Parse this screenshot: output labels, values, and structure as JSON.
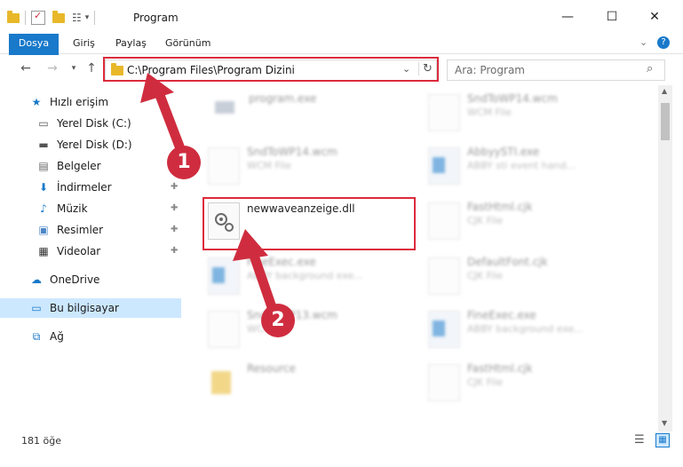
{
  "window": {
    "title": "Program"
  },
  "ribbon": {
    "tabs": [
      "Dosya",
      "Giriş",
      "Paylaş",
      "Görünüm"
    ]
  },
  "address": {
    "path": "C:\\Program Files\\Program Dizini"
  },
  "search": {
    "placeholder": "Ara: Program"
  },
  "sidebar": {
    "items": [
      {
        "label": "Hızlı erişim"
      },
      {
        "label": "Yerel Disk (C:)"
      },
      {
        "label": "Yerel Disk (D:)"
      },
      {
        "label": "Belgeler"
      },
      {
        "label": "İndirmeler"
      },
      {
        "label": "Müzik"
      },
      {
        "label": "Resimler"
      },
      {
        "label": "Videolar"
      },
      {
        "label": "OneDrive"
      },
      {
        "label": "Bu bilgisayar"
      },
      {
        "label": "Ağ"
      }
    ]
  },
  "files": [
    {
      "name": "program.exe",
      "type": ""
    },
    {
      "name": "SndToWP14.wcm",
      "type": "WCM File"
    },
    {
      "name": "SndToWP14.wcm",
      "type": "WCM File"
    },
    {
      "name": "AbbyySTI.exe",
      "type": "ABBY sti event hand..."
    },
    {
      "name": "newwaveanzeige.dll",
      "type": ""
    },
    {
      "name": "FastHtml.cjk",
      "type": "CJK File"
    },
    {
      "name": "FineExec.exe",
      "type": "ABBY background exe..."
    },
    {
      "name": "DefaultFont.cjk",
      "type": "CJK File"
    },
    {
      "name": "SndToWP13.wcm",
      "type": "WCM File"
    },
    {
      "name": "FineExec.exe",
      "type": "ABBY background exe..."
    },
    {
      "name": "Resource",
      "type": ""
    },
    {
      "name": "FastHtml.cjk",
      "type": "CJK File"
    }
  ],
  "callouts": [
    "1",
    "2"
  ],
  "status": {
    "count": "181 öğe"
  },
  "colors": {
    "accent": "#1979ca",
    "highlight": "#dc2b3c",
    "selected": "#cce8ff"
  }
}
